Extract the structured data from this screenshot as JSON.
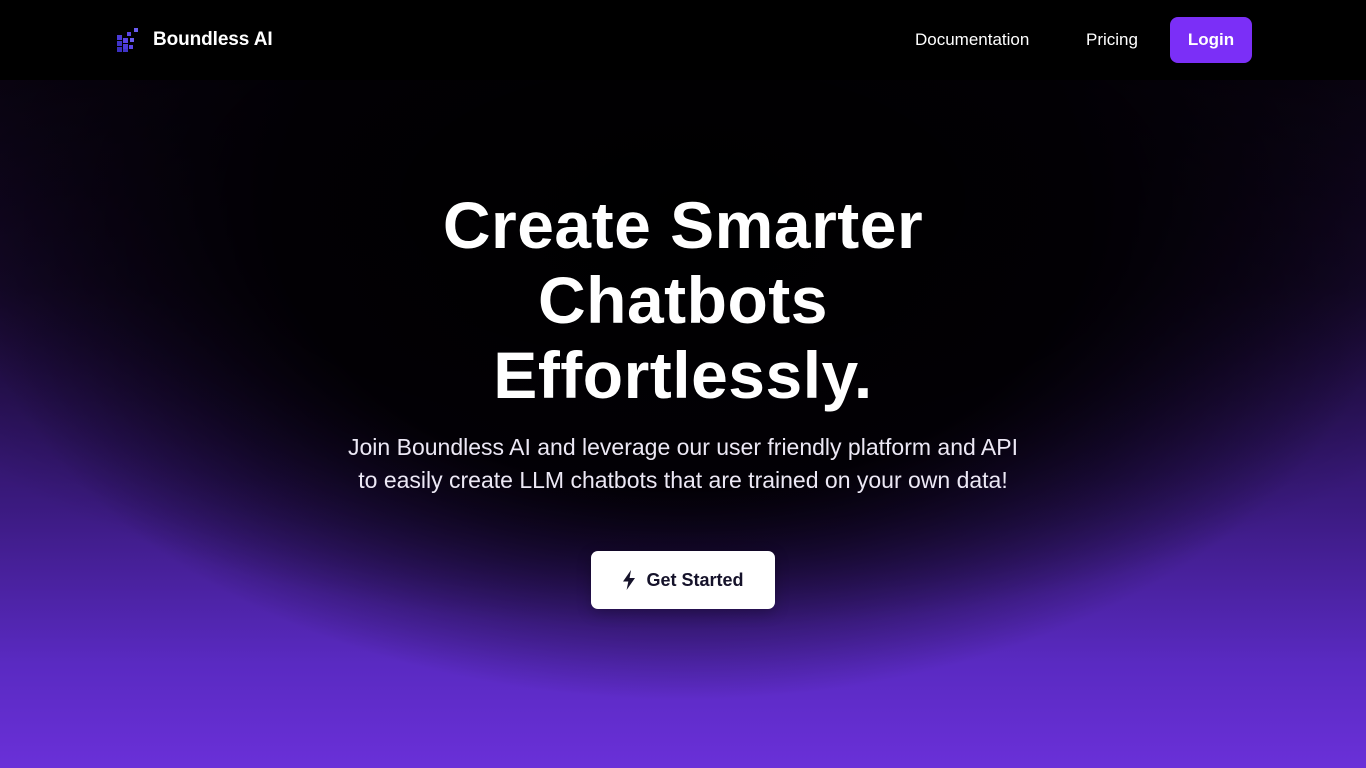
{
  "brand": {
    "name": "Boundless AI",
    "icon": "pixel-blocks-logo-icon",
    "accent_color": "#5b45e8"
  },
  "nav": {
    "links": [
      {
        "label": "Documentation"
      },
      {
        "label": "Pricing"
      }
    ],
    "login_label": "Login",
    "login_color": "#7b2ff7"
  },
  "hero": {
    "title_lines": [
      "Create Smarter",
      "Chatbots",
      "Effortlessly."
    ],
    "subtitle": "Join Boundless AI and leverage our user friendly platform and API to easily create LLM chatbots that are trained on your own data!",
    "cta": {
      "label": "Get Started",
      "icon": "lightning-bolt-icon"
    },
    "gradient_bottom_color": "#6a30d8"
  }
}
